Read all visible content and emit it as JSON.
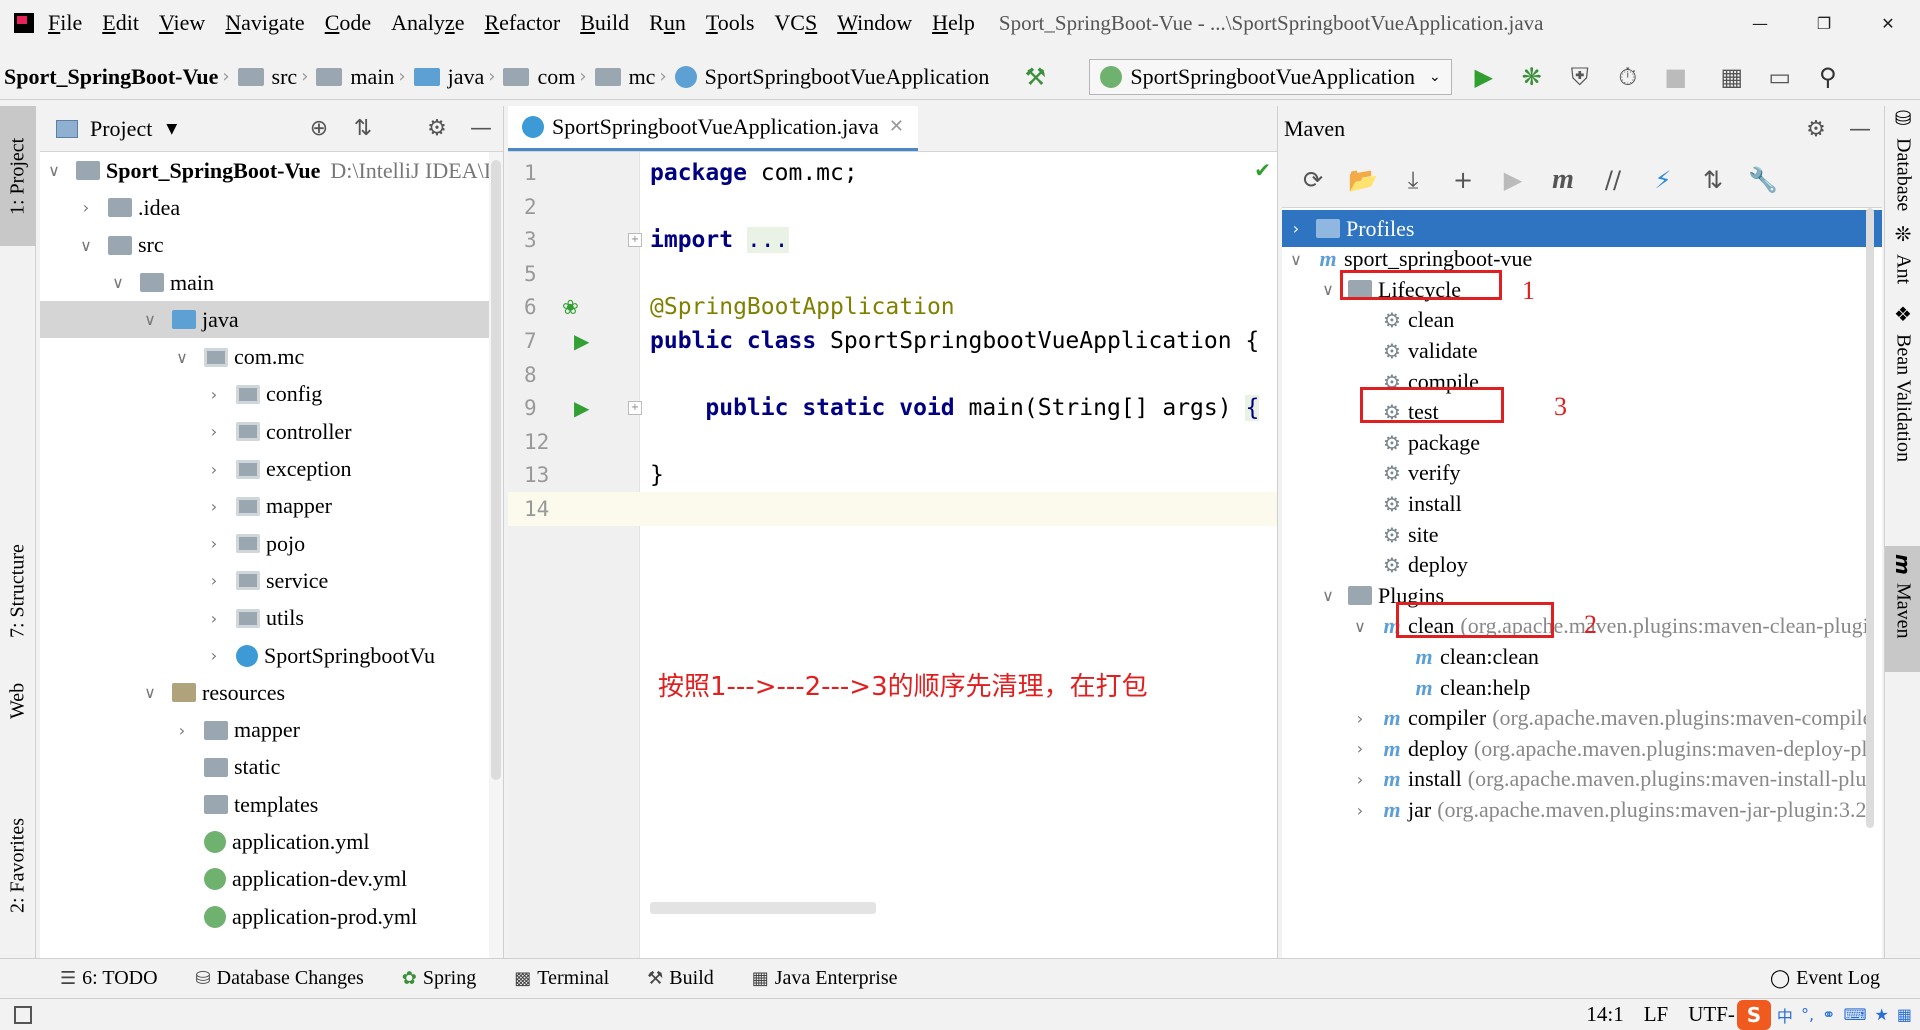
{
  "menu": {
    "items": [
      {
        "label": "File",
        "u": "F"
      },
      {
        "label": "Edit",
        "u": "E"
      },
      {
        "label": "View",
        "u": "V"
      },
      {
        "label": "Navigate",
        "u": "N"
      },
      {
        "label": "Code",
        "u": "C"
      },
      {
        "label": "Analyze",
        "u": "z"
      },
      {
        "label": "Refactor",
        "u": "R"
      },
      {
        "label": "Build",
        "u": "B"
      },
      {
        "label": "Run",
        "u": "u"
      },
      {
        "label": "Tools",
        "u": "T"
      },
      {
        "label": "VCS",
        "u": "S"
      },
      {
        "label": "Window",
        "u": "W"
      },
      {
        "label": "Help",
        "u": "H"
      }
    ],
    "window_title": "Sport_SpringBoot-Vue - ...\\SportSpringbootVueApplication.java"
  },
  "nav": {
    "project": "Sport_SpringBoot-Vue",
    "crumbs": [
      "src",
      "main",
      "java",
      "com",
      "mc",
      "SportSpringbootVueApplication"
    ],
    "run_config": "SportSpringbootVueApplication"
  },
  "left_stripe": {
    "project_tab": "1: Project",
    "structure_tab": "7: Structure",
    "web_tab": "Web",
    "favorites_tab": "2: Favorites"
  },
  "project": {
    "title": "Project",
    "rows": [
      {
        "label": "Sport_SpringBoot-Vue",
        "path": "D:\\IntelliJ IDEA\\Id",
        "indent": 0,
        "arrow": "open",
        "icon": "folder",
        "bold": true
      },
      {
        "label": ".idea",
        "indent": 1,
        "arrow": "closed",
        "icon": "folder"
      },
      {
        "label": "src",
        "indent": 1,
        "arrow": "open",
        "icon": "folder"
      },
      {
        "label": "main",
        "indent": 2,
        "arrow": "open",
        "icon": "folder"
      },
      {
        "label": "java",
        "indent": 3,
        "arrow": "open",
        "icon": "blue",
        "selected": true
      },
      {
        "label": "com.mc",
        "indent": 4,
        "arrow": "open",
        "icon": "pkg"
      },
      {
        "label": "config",
        "indent": 5,
        "arrow": "closed",
        "icon": "pkg"
      },
      {
        "label": "controller",
        "indent": 5,
        "arrow": "closed",
        "icon": "pkg"
      },
      {
        "label": "exception",
        "indent": 5,
        "arrow": "closed",
        "icon": "pkg"
      },
      {
        "label": "mapper",
        "indent": 5,
        "arrow": "closed",
        "icon": "pkg"
      },
      {
        "label": "pojo",
        "indent": 5,
        "arrow": "closed",
        "icon": "pkg"
      },
      {
        "label": "service",
        "indent": 5,
        "arrow": "closed",
        "icon": "pkg"
      },
      {
        "label": "utils",
        "indent": 5,
        "arrow": "closed",
        "icon": "pkg"
      },
      {
        "label": "SportSpringbootVu",
        "indent": 5,
        "arrow": "closed",
        "icon": "cls"
      },
      {
        "label": "resources",
        "indent": 3,
        "arrow": "open",
        "icon": "res"
      },
      {
        "label": "mapper",
        "indent": 4,
        "arrow": "closed",
        "icon": "folder"
      },
      {
        "label": "static",
        "indent": 4,
        "arrow": "none",
        "icon": "folder"
      },
      {
        "label": "templates",
        "indent": 4,
        "arrow": "none",
        "icon": "folder"
      },
      {
        "label": "application.yml",
        "indent": 4,
        "arrow": "none",
        "icon": "file"
      },
      {
        "label": "application-dev.yml",
        "indent": 4,
        "arrow": "none",
        "icon": "file"
      },
      {
        "label": "application-prod.yml",
        "indent": 4,
        "arrow": "none",
        "icon": "file"
      }
    ]
  },
  "editor": {
    "tab": "SportSpringbootVueApplication.java",
    "lines": [
      {
        "no": "1",
        "html": "<span class='kw'>package</span> com.mc;"
      },
      {
        "no": "2",
        "html": ""
      },
      {
        "no": "3",
        "html": "<span class='kw'>import</span> <span class='fold-box'>...</span>",
        "fold": true
      },
      {
        "no": "5",
        "html": ""
      },
      {
        "no": "6",
        "html": "<span class='ann'>@SpringBootApplication</span>",
        "mark": "bean"
      },
      {
        "no": "7",
        "html": "<span class='kw'>public class</span> SportSpringbootVueApplication {",
        "mark": "run"
      },
      {
        "no": "8",
        "html": ""
      },
      {
        "no": "9",
        "html": "    <span class='kw'>public static void</span> main(String[] args) <span class='fold-box'>{</span>",
        "mark": "run",
        "fold": true
      },
      {
        "no": "12",
        "html": ""
      },
      {
        "no": "13",
        "html": "}"
      },
      {
        "no": "14",
        "html": "",
        "current": true
      }
    ],
    "annotation": "按照1--->---2--->3的顺序先清理，在打包"
  },
  "maven": {
    "title": "Maven",
    "rows": [
      {
        "label": "Profiles",
        "indent": 0,
        "arrow": "closed",
        "icon": "folder",
        "selected": true
      },
      {
        "label": "sport_springboot-vue",
        "indent": 0,
        "arrow": "open",
        "icon": "m"
      },
      {
        "label": "Lifecycle",
        "indent": 1,
        "arrow": "open",
        "icon": "folder"
      },
      {
        "label": "clean",
        "indent": 2,
        "arrow": "none",
        "icon": "gear"
      },
      {
        "label": "validate",
        "indent": 2,
        "arrow": "none",
        "icon": "gear"
      },
      {
        "label": "compile",
        "indent": 2,
        "arrow": "none",
        "icon": "gear"
      },
      {
        "label": "test",
        "indent": 2,
        "arrow": "none",
        "icon": "gear"
      },
      {
        "label": "package",
        "indent": 2,
        "arrow": "none",
        "icon": "gear"
      },
      {
        "label": "verify",
        "indent": 2,
        "arrow": "none",
        "icon": "gear"
      },
      {
        "label": "install",
        "indent": 2,
        "arrow": "none",
        "icon": "gear"
      },
      {
        "label": "site",
        "indent": 2,
        "arrow": "none",
        "icon": "gear"
      },
      {
        "label": "deploy",
        "indent": 2,
        "arrow": "none",
        "icon": "gear"
      },
      {
        "label": "Plugins",
        "indent": 1,
        "arrow": "open",
        "icon": "folder"
      },
      {
        "label": "clean",
        "detail": "(org.apache.maven.plugins:maven-clean-plugi",
        "indent": 2,
        "arrow": "open",
        "icon": "m"
      },
      {
        "label": "clean:clean",
        "indent": 3,
        "arrow": "none",
        "icon": "m"
      },
      {
        "label": "clean:help",
        "indent": 3,
        "arrow": "none",
        "icon": "m"
      },
      {
        "label": "compiler",
        "detail": "(org.apache.maven.plugins:maven-compile",
        "indent": 2,
        "arrow": "closed",
        "icon": "m"
      },
      {
        "label": "deploy",
        "detail": "(org.apache.maven.plugins:maven-deploy-pl",
        "indent": 2,
        "arrow": "closed",
        "icon": "m"
      },
      {
        "label": "install",
        "detail": "(org.apache.maven.plugins:maven-install-plu",
        "indent": 2,
        "arrow": "closed",
        "icon": "m"
      },
      {
        "label": "jar",
        "detail": "(org.apache.maven.plugins:maven-jar-plugin:3.2",
        "indent": 2,
        "arrow": "closed",
        "icon": "m"
      }
    ],
    "markers": [
      "1",
      "3",
      "2"
    ]
  },
  "right_stripe": {
    "database_tab": "Database",
    "ant_tab": "Ant",
    "bean_tab": "Bean Validation",
    "maven_tab": "Maven"
  },
  "bottom_tools": {
    "todo": "6: TODO",
    "db_changes": "Database Changes",
    "spring": "Spring",
    "terminal": "Terminal",
    "build": "Build",
    "java_ee": "Java Enterprise",
    "event_log": "Event Log"
  },
  "status": {
    "position": "14:1",
    "line_sep": "LF",
    "encoding": "UTF-"
  }
}
